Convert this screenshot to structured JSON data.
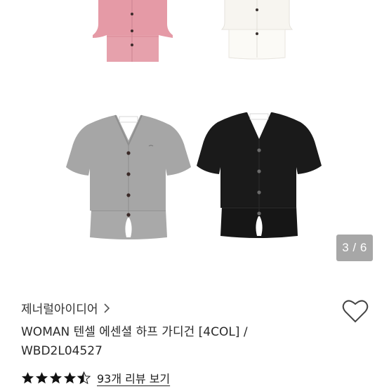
{
  "gallery": {
    "counter": "3 / 6",
    "images": [
      {
        "icon": "pink-cardigan",
        "color": "#e59aa6"
      },
      {
        "icon": "white-cardigan",
        "color": "#fbfaf7"
      },
      {
        "icon": "gray-cardigan",
        "color": "#a4a4a4"
      },
      {
        "icon": "black-cardigan",
        "color": "#191919"
      }
    ]
  },
  "product": {
    "brand": "제너럴아이디어",
    "title_line1": "WOMAN 텐셀 에센셜 하프 가디건 [4COL] /",
    "title_line2": "WBD2L04527",
    "rating": 4.5,
    "review_link": "93개 리뷰 보기"
  },
  "icons": {
    "wishlist": "heart-outline-icon",
    "brand_link": "chevron-right-icon",
    "rating": "star-icon"
  }
}
